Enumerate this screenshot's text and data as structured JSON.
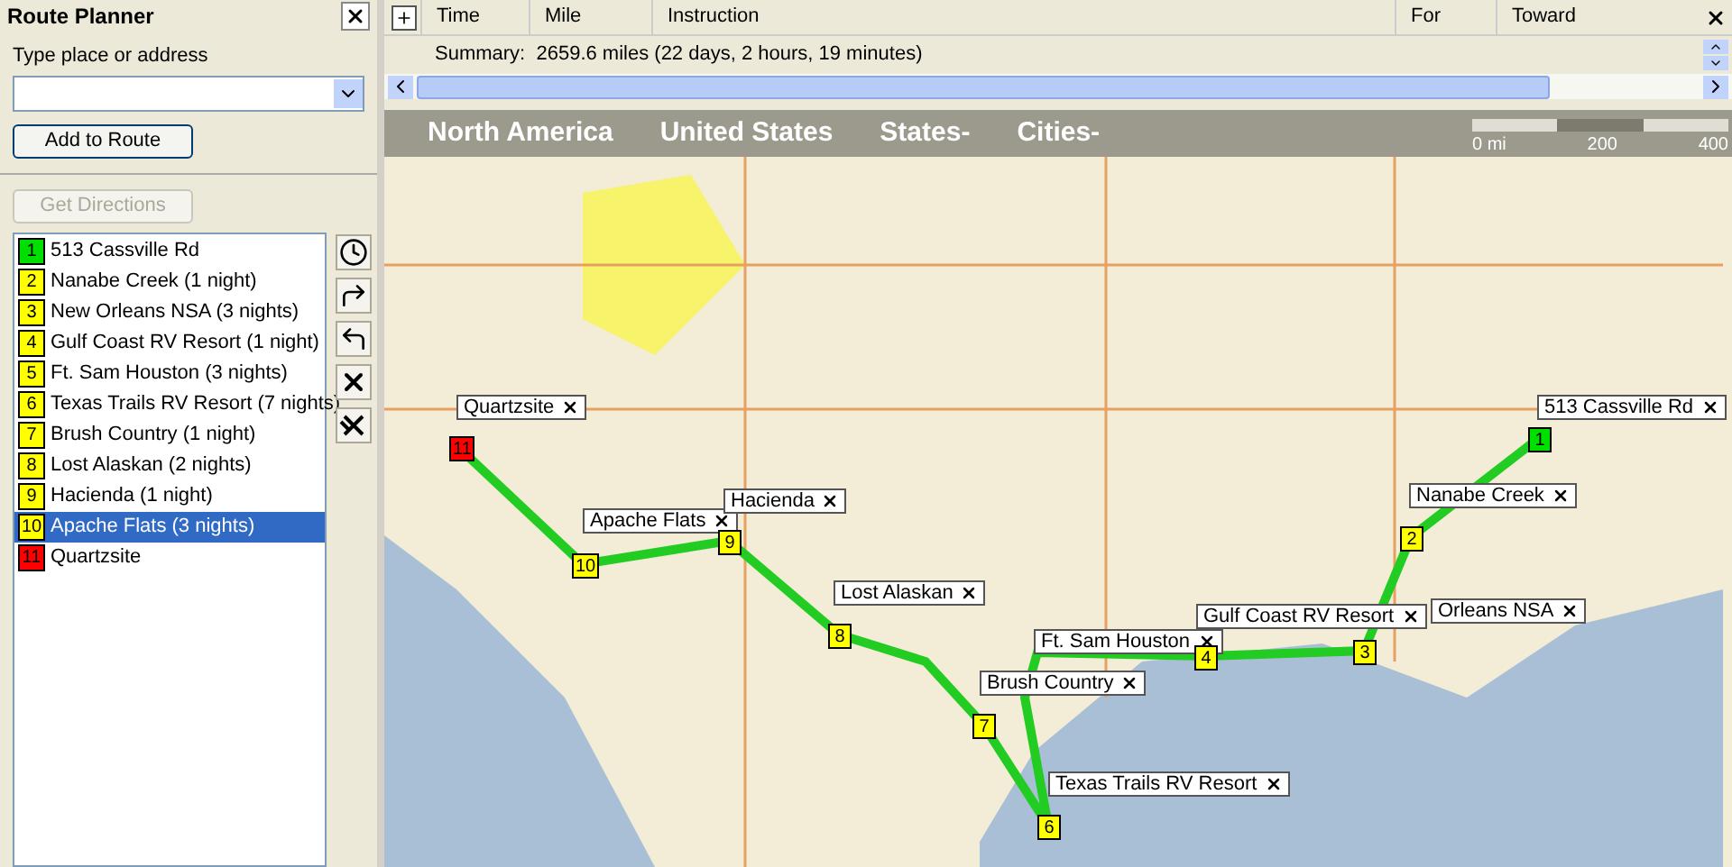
{
  "panel": {
    "title": "Route Planner",
    "field_label": "Type place or address",
    "add_button": "Add to Route",
    "directions_button": "Get Directions",
    "directions_disabled": true
  },
  "stops": [
    {
      "number": "1",
      "name": "513 Cassville Rd",
      "color": "#00e000",
      "selected": false
    },
    {
      "number": "2",
      "name": "Nanabe Creek (1 night)",
      "color": "#ffff00",
      "selected": false
    },
    {
      "number": "3",
      "name": "New Orleans NSA (3 nights)",
      "color": "#ffff00",
      "selected": false
    },
    {
      "number": "4",
      "name": "Gulf Coast RV Resort (1 night)",
      "color": "#ffff00",
      "selected": false
    },
    {
      "number": "5",
      "name": "Ft. Sam Houston (3 nights)",
      "color": "#ffff00",
      "selected": false
    },
    {
      "number": "6",
      "name": "Texas Trails RV Resort (7 nights)",
      "color": "#ffff00",
      "selected": false
    },
    {
      "number": "7",
      "name": "Brush Country (1 night)",
      "color": "#ffff00",
      "selected": false
    },
    {
      "number": "8",
      "name": "Lost Alaskan (2 nights)",
      "color": "#ffff00",
      "selected": false
    },
    {
      "number": "9",
      "name": "Hacienda (1 night)",
      "color": "#ffff00",
      "selected": false
    },
    {
      "number": "10",
      "name": "Apache Flats (3 nights)",
      "color": "#ffff00",
      "selected": true
    },
    {
      "number": "11",
      "name": "Quartzsite",
      "color": "#ff0000",
      "selected": false
    }
  ],
  "directions": {
    "columns": [
      "Time",
      "Mile",
      "Instruction",
      "For",
      "Toward"
    ],
    "summary": "Summary:  2659.6 miles (22 days, 2 hours, 19 minutes)"
  },
  "map": {
    "nav": [
      "North America",
      "United States",
      "States-",
      "Cities-"
    ],
    "scale": [
      "0 mi",
      "200",
      "400"
    ],
    "callouts": [
      "Quartzsite",
      "Apache Flats",
      "Hacienda",
      "Lost Alaskan",
      "Ft. Sam Houston",
      "Brush Country",
      "Texas Trails RV Resort",
      "Gulf Coast RV Resort",
      "Orleans NSA",
      "513 Cassville Rd",
      "Nanabe Creek"
    ],
    "markers": [
      {
        "number": "1",
        "color": "#00e000"
      },
      {
        "number": "2",
        "color": "#ffff00"
      },
      {
        "number": "3",
        "color": "#ffff00"
      },
      {
        "number": "4",
        "color": "#ffff00"
      },
      {
        "number": "6",
        "color": "#ffff00"
      },
      {
        "number": "7",
        "color": "#ffff00"
      },
      {
        "number": "8",
        "color": "#ffff00"
      },
      {
        "number": "9",
        "color": "#ffff00"
      },
      {
        "number": "10",
        "color": "#ffff00"
      },
      {
        "number": "11",
        "color": "#ff0000"
      }
    ]
  }
}
